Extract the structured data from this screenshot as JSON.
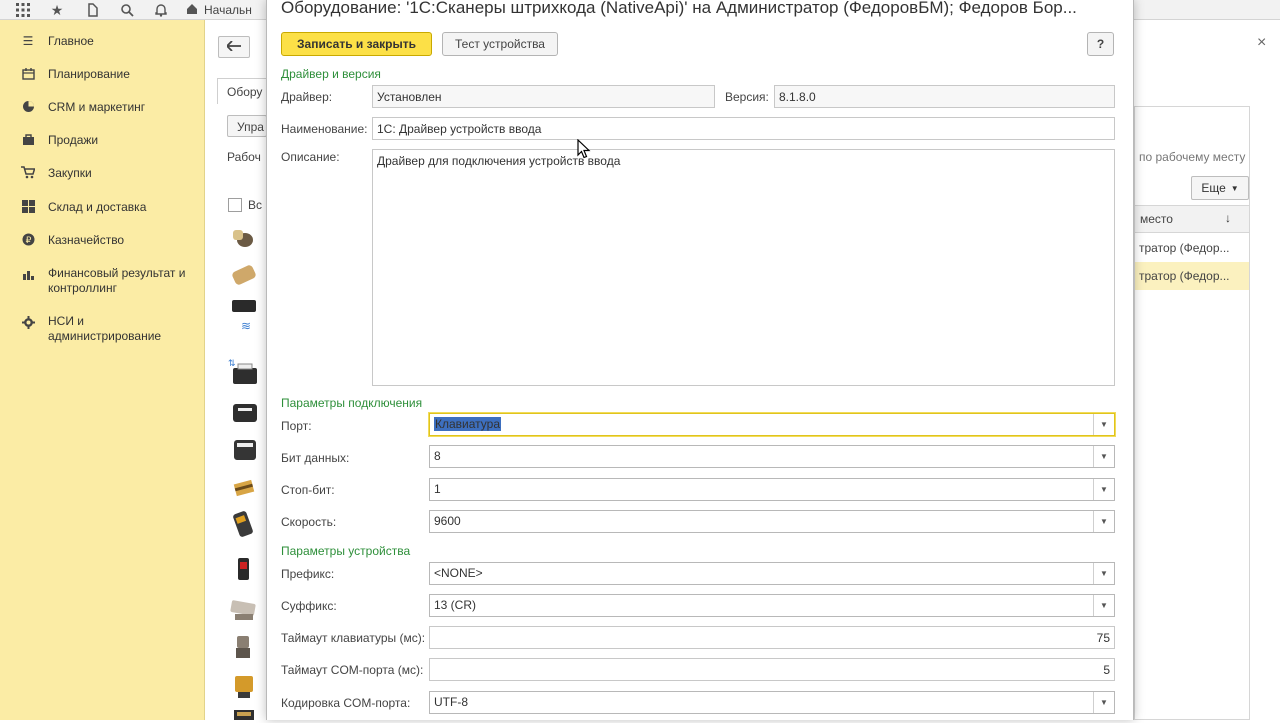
{
  "topbar": {
    "icons": [
      "apps-grid-icon",
      "star-icon",
      "history-icon",
      "search-icon",
      "bell-icon",
      "home-icon"
    ],
    "home_tab_label": "Начальн"
  },
  "sidebar": {
    "items": [
      {
        "label": "Главное",
        "icon": "menu-icon"
      },
      {
        "label": "Планирование",
        "icon": "planning-icon"
      },
      {
        "label": "CRM и маркетинг",
        "icon": "crm-icon"
      },
      {
        "label": "Продажи",
        "icon": "sales-icon"
      },
      {
        "label": "Закупки",
        "icon": "cart-icon"
      },
      {
        "label": "Склад и доставка",
        "icon": "warehouse-icon"
      },
      {
        "label": "Казначейство",
        "icon": "treasury-icon"
      },
      {
        "label": "Финансовый результат и контроллинг",
        "icon": "chart-icon"
      },
      {
        "label": "НСИ и администрирование",
        "icon": "gear-icon"
      }
    ]
  },
  "background": {
    "tab_label": "Обору",
    "manage_btn": "Упра",
    "workplace_label": "Рабоч",
    "checkbox_label": "Вс",
    "filter_hint": "по рабочему месту",
    "more_btn": "Еще",
    "column_header": "место",
    "rows": [
      "тратор (Федор...",
      "тратор (Федор..."
    ],
    "close_glyph": "×"
  },
  "dialog": {
    "title": "Оборудование: '1С:Сканеры штрихкода (NativeApi)' на Администратор (ФедоровБМ); Федоров Бор...",
    "save_close_btn": "Записать и закрыть",
    "test_btn": "Тест устройства",
    "help_btn": "?",
    "section_driver": "Драйвер и версия",
    "driver_label": "Драйвер:",
    "driver_value": "Установлен",
    "version_label": "Версия:",
    "version_value": "8.1.8.0",
    "name_label": "Наименование:",
    "name_value": "1С: Драйвер устройств ввода",
    "desc_label": "Описание:",
    "desc_value": "Драйвер для подключения устройств ввода",
    "section_connection": "Параметры подключения",
    "port_label": "Порт:",
    "port_value": "Клавиатура",
    "databits_label": "Бит данных:",
    "databits_value": "8",
    "stopbit_label": "Стоп-бит:",
    "stopbit_value": "1",
    "speed_label": "Скорость:",
    "speed_value": "9600",
    "section_device": "Параметры устройства",
    "prefix_label": "Префикс:",
    "prefix_value": "<NONE>",
    "suffix_label": "Суффикс:",
    "suffix_value": "13 (CR)",
    "kb_timeout_label": "Таймаут клавиатуры (мс):",
    "kb_timeout_value": "75",
    "com_timeout_label": "Таймаут COM-порта (мс):",
    "com_timeout_value": "5",
    "encoding_label": "Кодировка COM-порта:",
    "encoding_value": "UTF-8"
  },
  "colors": {
    "sidebar_bg": "#fbeca5",
    "primary_button": "#fce047",
    "section_heading": "#2e8f3a",
    "selection": "#3d6fbf"
  }
}
